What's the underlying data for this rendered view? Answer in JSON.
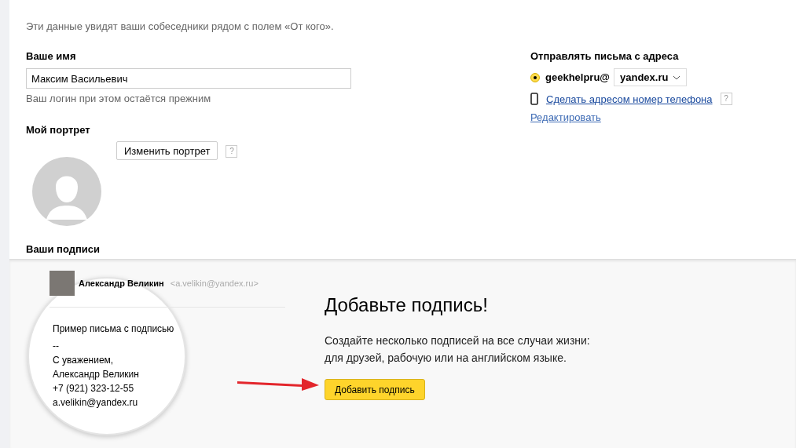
{
  "intro": "Эти данные увидят ваши собеседники рядом с полем «От кого».",
  "name_section": {
    "label": "Ваше имя",
    "value": "Максим Васильевич",
    "hint": "Ваш логин при этом остаётся прежним"
  },
  "portrait": {
    "label": "Мой портрет",
    "button": "Изменить портрет",
    "help": "?"
  },
  "sender": {
    "label": "Отправлять письма с адреса",
    "addresses": [
      {
        "login": "geekhelpru@",
        "domain": "yandex.ru",
        "selected": true
      }
    ],
    "phone_link": "Сделать адресом номер телефона",
    "help": "?",
    "edit_link": "Редактировать"
  },
  "signatures": {
    "label": "Ваши подписи",
    "example": {
      "sender_name": "Александр Великин",
      "sender_email": "<a.velikin@yandex.ru>",
      "lines": [
        "Пример письма с подписью",
        "--",
        "С уважением,",
        "Александр Великин",
        "+7 (921) 323-12-55",
        "a.velikin@yandex.ru"
      ]
    },
    "promo": {
      "title": "Добавьте подпись!",
      "text": "Создайте несколько подписей на все случаи жизни:\nдля друзей, рабочую или на английском языке.",
      "button": "Добавить подпись"
    }
  }
}
